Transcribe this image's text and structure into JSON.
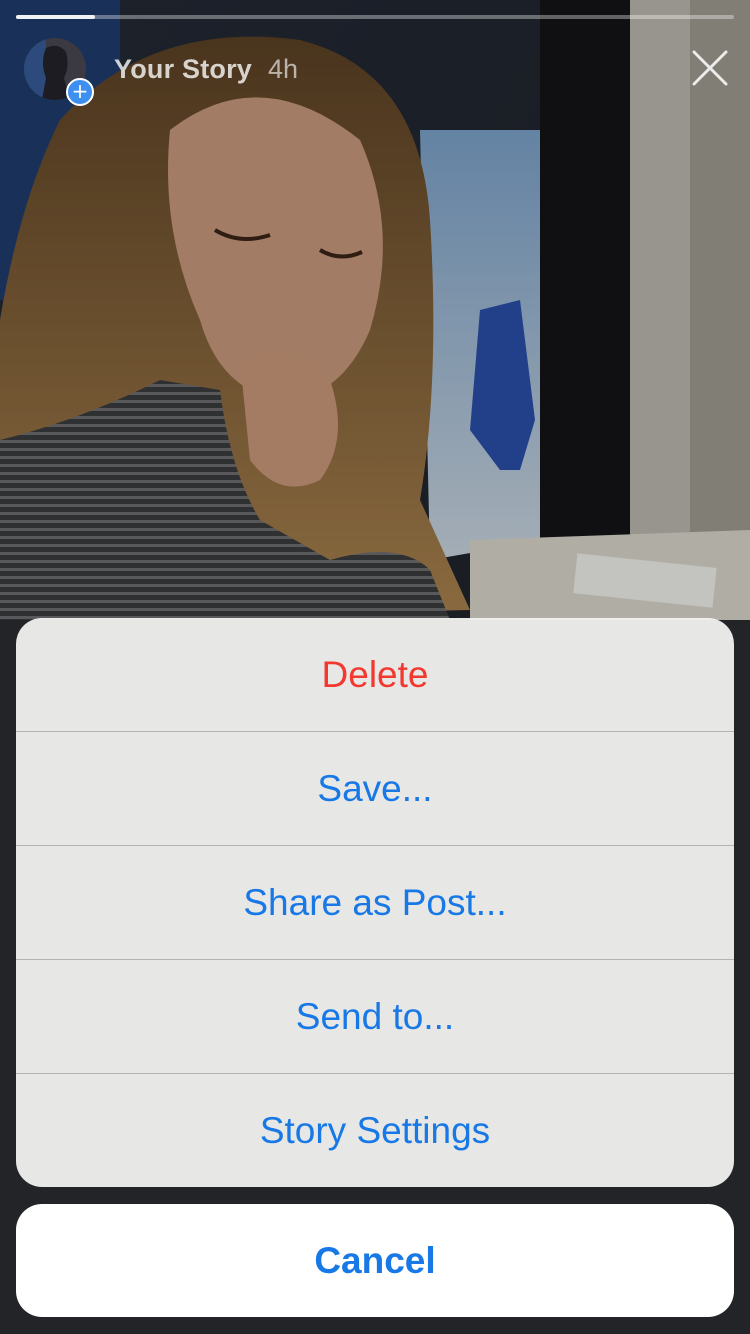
{
  "story": {
    "title": "Your Story",
    "time": "4h",
    "progress": 0.11,
    "avatar_badge_icon": "plus-icon",
    "close_icon": "close-icon"
  },
  "action_sheet": {
    "items": [
      {
        "label": "Delete",
        "style": "destructive"
      },
      {
        "label": "Save...",
        "style": "default"
      },
      {
        "label": "Share as Post...",
        "style": "default"
      },
      {
        "label": "Send to...",
        "style": "default"
      },
      {
        "label": "Story Settings",
        "style": "default"
      }
    ],
    "cancel_label": "Cancel"
  },
  "colors": {
    "action_blue": "#1778e6",
    "destructive_red": "#f2382f",
    "badge_blue": "#3d8ff0"
  }
}
